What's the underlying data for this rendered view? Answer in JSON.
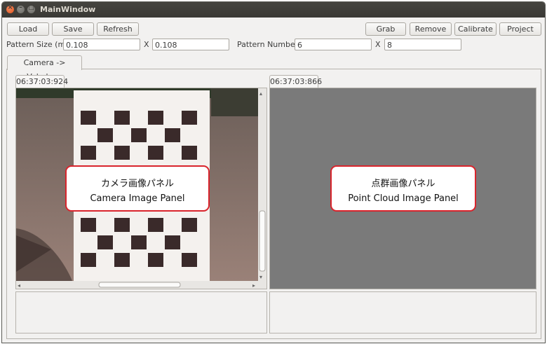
{
  "window": {
    "title": "MainWindow",
    "close_glyph": "×",
    "min_glyph": "–",
    "max_glyph": "□"
  },
  "toolbar": {
    "load": "Load",
    "save": "Save",
    "refresh": "Refresh",
    "grab": "Grab",
    "remove": "Remove",
    "calibrate": "Calibrate",
    "project": "Project"
  },
  "params": {
    "pattern_size_label": "Pattern Size (m)",
    "pattern_size_x": "0.108",
    "pattern_size_sep": "X",
    "pattern_size_y": "0.108",
    "pattern_number_label": "Pattern Number",
    "pattern_number_x": "6",
    "pattern_number_sep": "X",
    "pattern_number_y": "8"
  },
  "tabs": [
    {
      "label": "Camera -> Velodyne"
    }
  ],
  "camera_panel": {
    "timestamp": "06:37:03:924",
    "callout_jp": "カメラ画像パネル",
    "callout_en": "Camera Image Panel"
  },
  "cloud_panel": {
    "timestamp": "06:37:03:866",
    "callout_jp": "点群画像パネル",
    "callout_en": "Point Cloud Image Panel"
  },
  "colors": {
    "callout_border": "#d9242c",
    "cloud_bg": "#7a7a7a",
    "titlebar": "#3f3e3a"
  }
}
